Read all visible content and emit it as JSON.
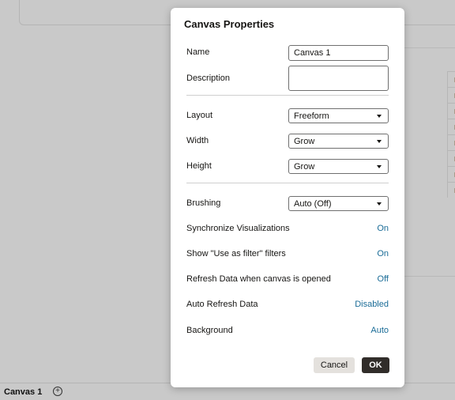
{
  "footer": {
    "canvas_tab": "Canvas 1",
    "add_icon": "plus-circle-icon"
  },
  "dialog": {
    "title": "Canvas Properties",
    "name_label": "Name",
    "name_value": "Canvas 1",
    "description_label": "Description",
    "description_value": "",
    "layout_label": "Layout",
    "layout_value": "Freeform",
    "width_label": "Width",
    "width_value": "Grow",
    "height_label": "Height",
    "height_value": "Grow",
    "brushing_label": "Brushing",
    "brushing_value": "Auto (Off)",
    "sync_label": "Synchronize Visualizations",
    "sync_value": "On",
    "filters_label": "Show \"Use as filter\" filters",
    "filters_value": "On",
    "refresh_open_label": "Refresh Data when canvas is opened",
    "refresh_open_value": "Off",
    "auto_refresh_label": "Auto Refresh Data",
    "auto_refresh_value": "Disabled",
    "background_label": "Background",
    "background_value": "Auto",
    "cancel_label": "Cancel",
    "ok_label": "OK"
  },
  "colors": {
    "link": "#1a6c97",
    "primary_button": "#312d2a",
    "secondary_button": "#e4e1dd",
    "overlay": "#c9c9c9"
  }
}
